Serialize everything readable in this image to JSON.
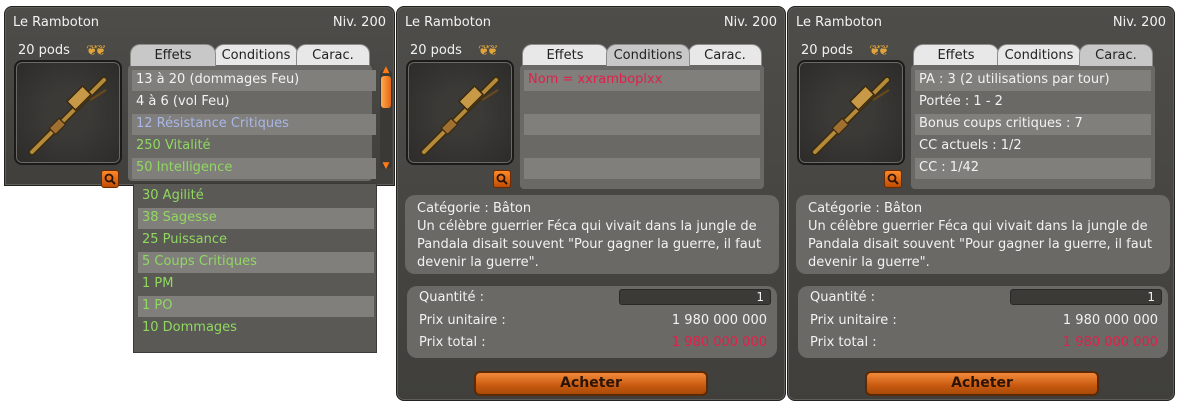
{
  "panels": [
    {
      "title": "Le Ramboton",
      "level": "Niv. 200",
      "pods": "20 pods",
      "active_tab": "effets",
      "tabs": {
        "effets": "Effets",
        "conditions": "Conditions",
        "carac": "Carac."
      },
      "rows": [
        {
          "text": "13 à 20 (dommages Feu)",
          "color": "white"
        },
        {
          "text": "4 à 6 (vol Feu)",
          "color": "white"
        },
        {
          "text": "12 Résistance Critiques",
          "color": "blue"
        },
        {
          "text": "250 Vitalité",
          "color": "green"
        },
        {
          "text": "50 Intelligence",
          "color": "green"
        }
      ],
      "overflow_rows": [
        {
          "text": "30 Agilité",
          "color": "green"
        },
        {
          "text": "38 Sagesse",
          "color": "green"
        },
        {
          "text": "25 Puissance",
          "color": "green"
        },
        {
          "text": "5 Coups Critiques",
          "color": "green"
        },
        {
          "text": "1 PM",
          "color": "green"
        },
        {
          "text": "1 PO",
          "color": "green"
        },
        {
          "text": "10 Dommages",
          "color": "green"
        }
      ]
    },
    {
      "title": "Le Ramboton",
      "level": "Niv. 200",
      "pods": "20 pods",
      "active_tab": "conditions",
      "tabs": {
        "effets": "Effets",
        "conditions": "Conditions",
        "carac": "Carac."
      },
      "rows": [
        {
          "text": "Nom = xxramboplxx",
          "color": "red"
        },
        {
          "text": "",
          "color": "white"
        },
        {
          "text": "",
          "color": "white"
        },
        {
          "text": "",
          "color": "white"
        },
        {
          "text": "",
          "color": "white"
        }
      ],
      "description": {
        "category": "Catégorie : Bâton",
        "lines": [
          "Un célèbre guerrier Féca qui vivait dans la jungle de",
          "Pandala disait souvent \"Pour gagner la guerre, il faut",
          "devenir la guerre\"."
        ]
      },
      "purchase": {
        "quantity_label": "Quantité :",
        "quantity_value": "1",
        "unit_price_label": "Prix unitaire :",
        "unit_price": "1 980 000 000",
        "total_label": "Prix total :",
        "total_price": "1 980 000 000",
        "buy_label": "Acheter"
      }
    },
    {
      "title": "Le Ramboton",
      "level": "Niv. 200",
      "pods": "20 pods",
      "active_tab": "carac",
      "tabs": {
        "effets": "Effets",
        "conditions": "Conditions",
        "carac": "Carac."
      },
      "rows": [
        {
          "text": "PA : 3 (2 utilisations par tour)",
          "color": "white"
        },
        {
          "text": "Portée : 1 - 2",
          "color": "white"
        },
        {
          "text": "Bonus coups critiques : 7",
          "color": "white"
        },
        {
          "text": "CC actuels : 1/2",
          "color": "white"
        },
        {
          "text": "CC : 1/42",
          "color": "white"
        }
      ],
      "description": {
        "category": "Catégorie : Bâton",
        "lines": [
          "Un célèbre guerrier Féca qui vivait dans la jungle de",
          "Pandala disait souvent \"Pour gagner la guerre, il faut",
          "devenir la guerre\"."
        ]
      },
      "purchase": {
        "quantity_label": "Quantité :",
        "quantity_value": "1",
        "unit_price_label": "Prix unitaire :",
        "unit_price": "1 980 000 000",
        "total_label": "Prix total :",
        "total_price": "1 980 000 000",
        "buy_label": "Acheter"
      }
    }
  ],
  "colors": {
    "white": "#f2f2f2",
    "blue": "#a9b6e8",
    "green": "#90d860",
    "red": "#e0204a",
    "accent_orange": "#e46612"
  },
  "icons": {
    "pods": "pods-icon",
    "item": "rifle-staff-icon",
    "zoom": "magnifier-icon",
    "scroll_up": "arrow-up-icon",
    "scroll_down": "arrow-down-icon"
  }
}
